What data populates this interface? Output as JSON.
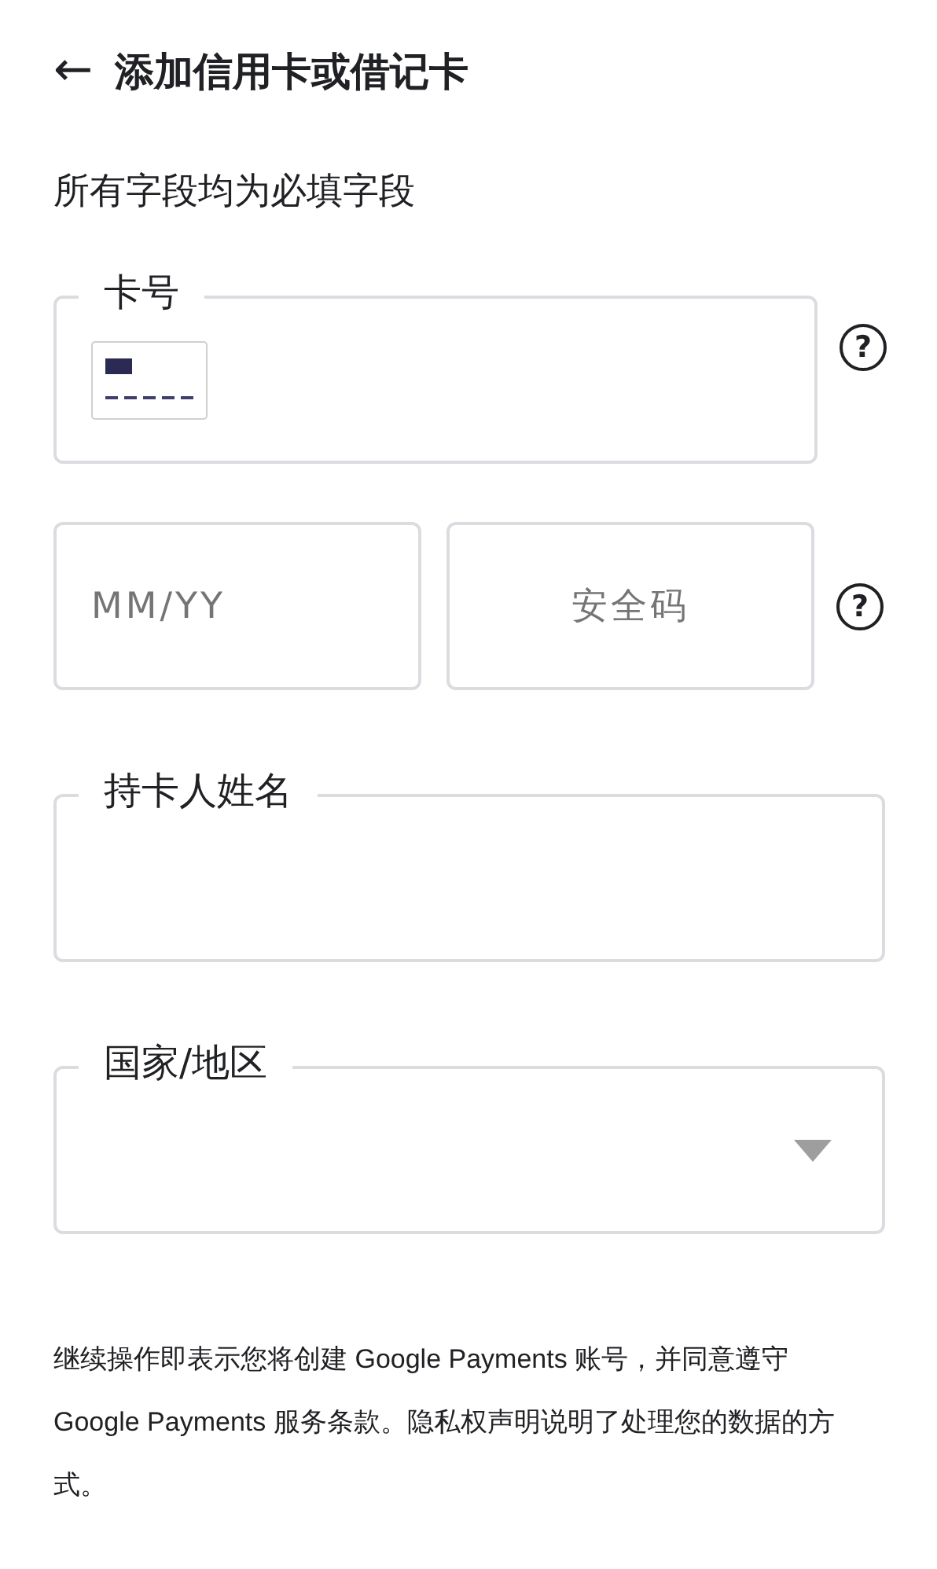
{
  "header": {
    "back": "←",
    "title": "添加信用卡或借记卡"
  },
  "subtitle": "所有字段均为必填字段",
  "card_number": {
    "label": "卡号",
    "help": "?"
  },
  "expiry": {
    "placeholder": "MM/YY"
  },
  "security_code": {
    "placeholder": "安全码",
    "help": "?"
  },
  "cardholder": {
    "label": "持卡人姓名"
  },
  "country": {
    "label": "国家/地区"
  },
  "footer": "继续操作即表示您将创建 Google Payments 账号，并同意遵守 Google Payments 服务条款。隐私权声明说明了处理您的数据的方式。"
}
